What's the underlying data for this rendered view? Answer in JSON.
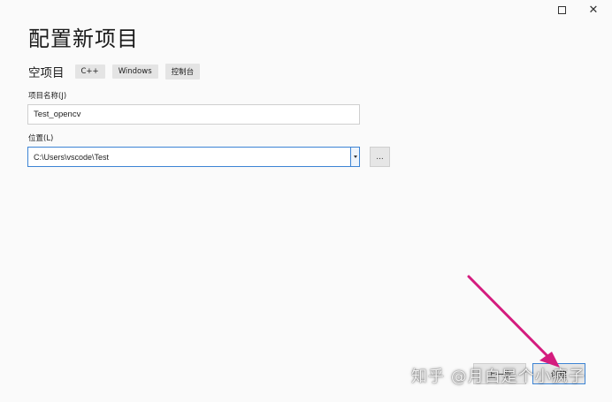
{
  "window": {
    "maximize_icon": "maximize-icon",
    "close_icon": "close-icon",
    "close_glyph": "✕"
  },
  "page": {
    "title": "配置新项目"
  },
  "template": {
    "name": "空项目",
    "tags": [
      "C++",
      "Windows",
      "控制台"
    ]
  },
  "project_name": {
    "label": "项目名称(J)",
    "value": "Test_opencv"
  },
  "location": {
    "label": "位置(L)",
    "value": "C:\\Users\\vscode\\Test",
    "dropdown_icon": "chevron-down-icon",
    "browse_label": "..."
  },
  "buttons": {
    "back_label": "上一步",
    "create_label": "创建"
  },
  "annotation": {
    "arrow_color": "#d41c7e"
  },
  "watermark": {
    "text": "知乎 @月白是个小疯子"
  },
  "colors": {
    "accent": "#3d84d4",
    "background": "#fafafa"
  }
}
